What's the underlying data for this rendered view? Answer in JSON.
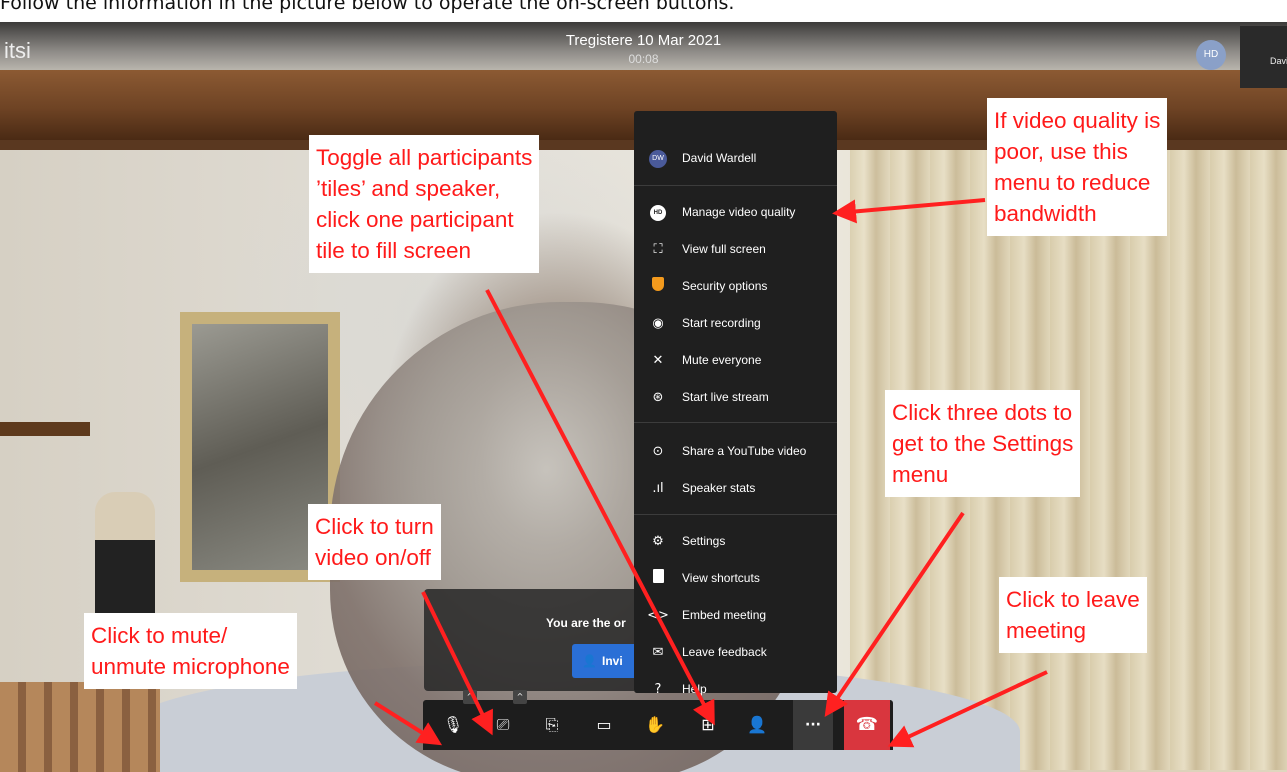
{
  "instruction": "Follow the information in the picture below to operate the on-screen buttons.",
  "meeting": {
    "brand": "itsi",
    "title": "Tregistere 10 Mar 2021",
    "timer": "00:08",
    "self_avatar": "HD",
    "thumbnail_name": "David"
  },
  "menu": {
    "user": {
      "initials": "DW",
      "name": "David Wardell"
    },
    "items": [
      {
        "icon": "hd-icon",
        "label": "Manage video quality"
      },
      {
        "icon": "fullscreen-icon",
        "label": "View full screen"
      },
      {
        "icon": "shield-icon",
        "label": "Security options"
      },
      {
        "icon": "record-icon",
        "label": "Start recording"
      },
      {
        "icon": "mute-everyone-icon",
        "label": "Mute everyone"
      },
      {
        "icon": "live-stream-icon",
        "label": "Start live stream"
      },
      {
        "icon": "youtube-play-icon",
        "label": "Share a YouTube video"
      },
      {
        "icon": "stats-icon",
        "label": "Speaker stats"
      },
      {
        "icon": "gear-icon",
        "label": "Settings"
      },
      {
        "icon": "document-icon",
        "label": "View shortcuts"
      },
      {
        "icon": "embed-icon",
        "label": "Embed meeting"
      },
      {
        "icon": "feedback-icon",
        "label": "Leave feedback"
      },
      {
        "icon": "help-icon",
        "label": "Help"
      }
    ]
  },
  "lonely_meeting": {
    "message": "You are the or",
    "invite_label": "Invi"
  },
  "toolbar": {
    "buttons": [
      "microphone-icon",
      "camera-icon",
      "screen-share-icon",
      "chat-icon",
      "raise-hand-icon",
      "tile-view-icon",
      "invite-icon",
      "more-dots-icon",
      "hangup-icon"
    ]
  },
  "callouts": {
    "tiles": [
      "Toggle all participants",
      "’tiles’ and speaker,",
      "click one participant",
      "tile to fill screen"
    ],
    "quality": [
      "If video quality is",
      "poor, use this",
      "menu to reduce",
      "bandwidth"
    ],
    "settings": [
      "Click three dots to",
      "get to the Settings",
      "menu"
    ],
    "video": [
      "Click to turn",
      "video on/off"
    ],
    "leave": [
      "Click to leave",
      "meeting"
    ],
    "mic": [
      "Click to mute/",
      "unmute microphone"
    ]
  },
  "colors": {
    "callout_text": "#ff1a1a",
    "arrow": "#ff2020",
    "menu_bg": "#1f1f1f",
    "invite_button": "#2a6fd6",
    "hangup": "#d9363e"
  }
}
